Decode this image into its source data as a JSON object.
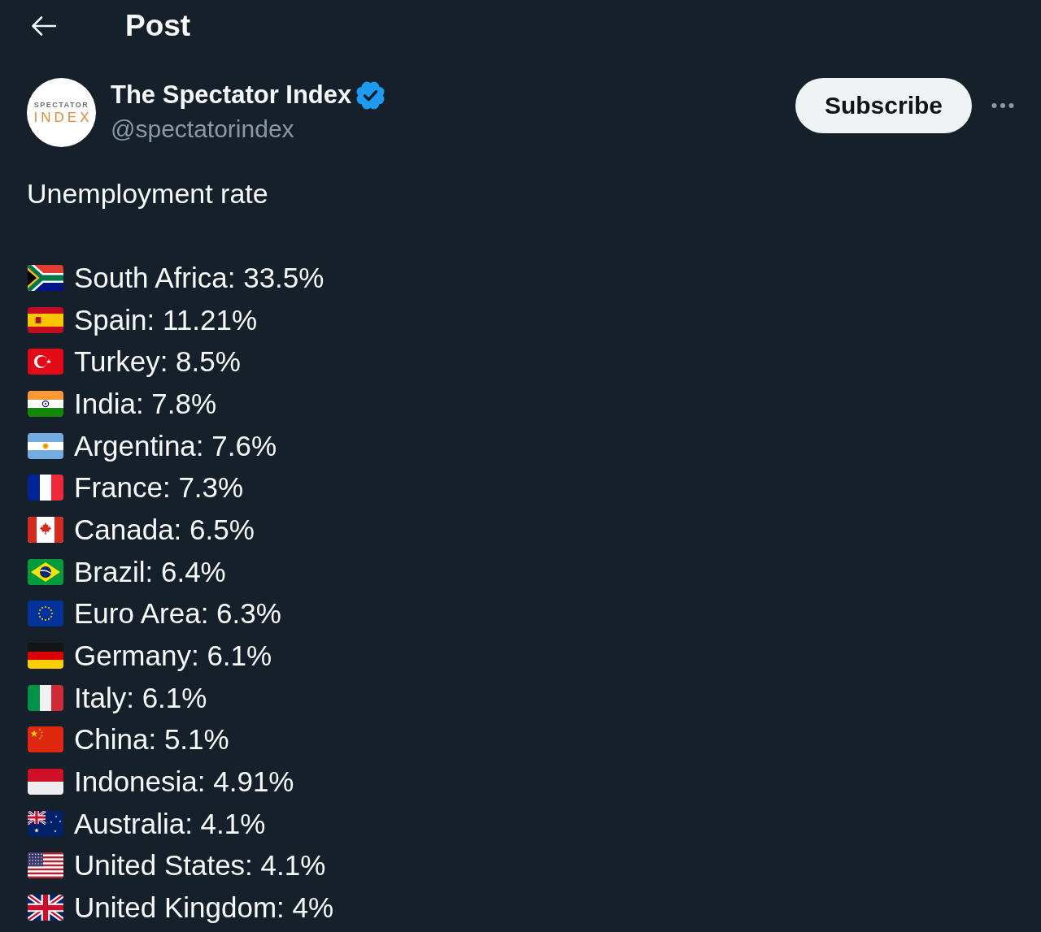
{
  "header": {
    "title": "Post"
  },
  "author": {
    "avatar": {
      "line_1": "SPECTATOR",
      "line_2": "INDEX"
    },
    "name": "The Spectator Index",
    "verified": true,
    "handle": "@spectatorindex"
  },
  "subscribe_button": "Subscribe",
  "post": {
    "title": "Unemployment rate",
    "rows": [
      {
        "kind": "za",
        "text": "South Africa: 33.5%"
      },
      {
        "kind": "es",
        "text": "Spain: 11.21%"
      },
      {
        "kind": "tr",
        "text": "Turkey: 8.5%"
      },
      {
        "kind": "in",
        "text": "India: 7.8%"
      },
      {
        "kind": "ar",
        "text": "Argentina: 7.6%"
      },
      {
        "kind": "fr",
        "text": "France: 7.3%"
      },
      {
        "kind": "ca",
        "text": "Canada: 6.5%"
      },
      {
        "kind": "br",
        "text": "Brazil: 6.4%"
      },
      {
        "kind": "eu",
        "text": "Euro Area: 6.3%"
      },
      {
        "kind": "de",
        "text": "Germany: 6.1%"
      },
      {
        "kind": "it",
        "text": "Italy: 6.1%"
      },
      {
        "kind": "cn",
        "text": "China: 5.1%"
      },
      {
        "kind": "id",
        "text": "Indonesia: 4.91%"
      },
      {
        "kind": "au",
        "text": "Australia: 4.1%"
      },
      {
        "kind": "us",
        "text": "United States: 4.1%"
      },
      {
        "kind": "gb",
        "text": "United Kingdom: 4%"
      }
    ]
  }
}
